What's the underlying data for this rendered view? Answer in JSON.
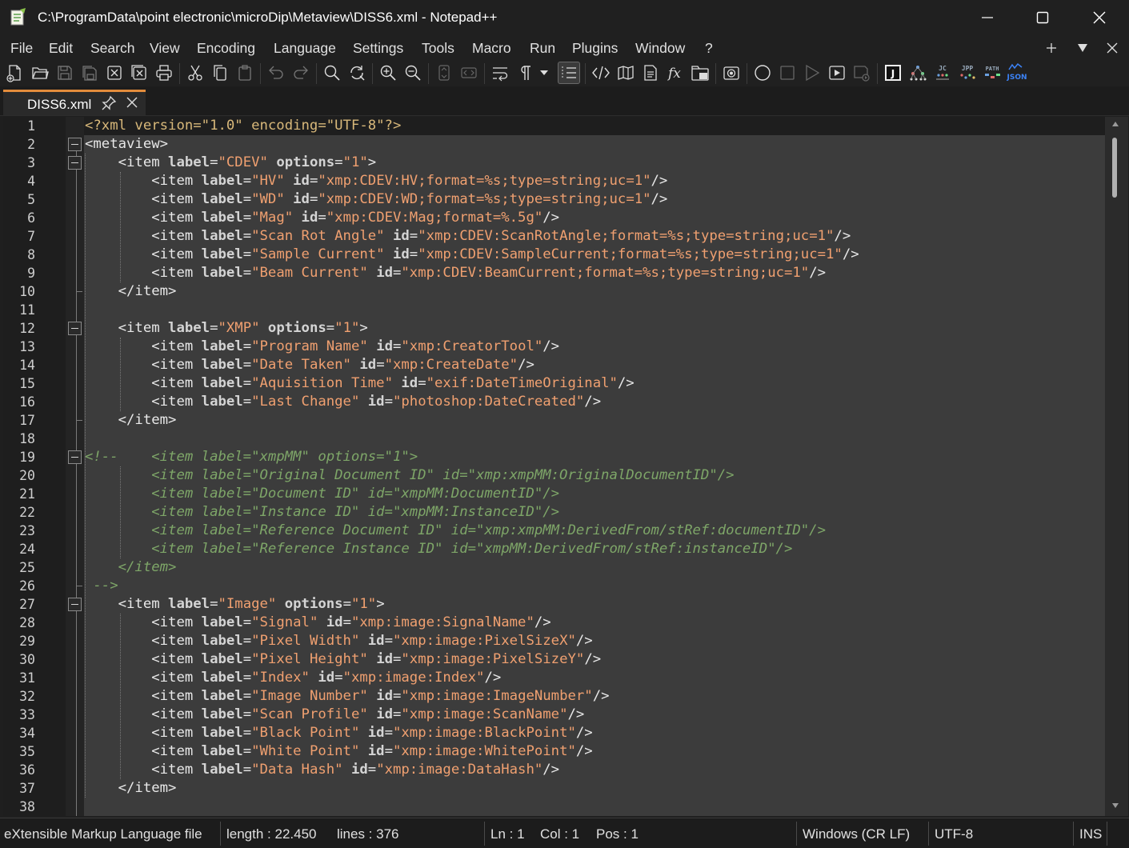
{
  "window": {
    "title": "C:\\ProgramData\\point electronic\\microDip\\Metaview\\DISS6.xml - Notepad++",
    "minimize_icon": "minimize-icon",
    "maximize_icon": "maximize-icon",
    "close_icon": "close-icon"
  },
  "menu": {
    "items": [
      "File",
      "Edit",
      "Search",
      "View",
      "Encoding",
      "Language",
      "Settings",
      "Tools",
      "Macro",
      "Run",
      "Plugins",
      "Window",
      "?"
    ],
    "right_icons": [
      "plus-icon",
      "dropdown-triangle-icon",
      "close-icon"
    ],
    "right_labels": [
      "+",
      "▼",
      "✕"
    ]
  },
  "toolbar": {
    "icons": [
      "new-file-icon",
      "open-folder-icon",
      "save-icon",
      "save-all-icon",
      "close-file-icon",
      "close-all-icon",
      "print-icon",
      "cut-icon",
      "copy-icon",
      "paste-icon",
      "undo-icon",
      "redo-icon",
      "find-icon",
      "replace-icon",
      "zoom-in-icon",
      "zoom-out-icon",
      "sync-vertical-icon",
      "sync-horizontal-icon",
      "word-wrap-icon",
      "show-all-characters-icon",
      "dropdown-icon",
      "indent-guide-icon",
      "xml-tag-icon",
      "document-map-icon",
      "document-list-icon",
      "function-list-icon",
      "folder-as-workspace-icon",
      "monitoring-icon",
      "record-macro-icon",
      "stop-macro-icon",
      "play-macro-icon",
      "run-macro-multiple-icon",
      "save-macro-icon",
      "jstool-icon",
      "plugin-tree-icon",
      "jc-plugin-icon",
      "jpp-plugin-icon",
      "path-plugin-icon",
      "json-plugin-icon"
    ],
    "plugin_labels": {
      "j": "J",
      "jc": "JC",
      "jpp": "JPP",
      "path": "PATH",
      "json": "JSON"
    }
  },
  "tabs": [
    {
      "label": "DISS6.xml",
      "pin_icon": "pin-icon",
      "close_icon": "close-icon",
      "active": true
    }
  ],
  "editor": {
    "current_line": 1,
    "lines": [
      [
        [
          "dec",
          "<?xml version=\"1.0\" encoding=\"UTF-8\"?>"
        ]
      ],
      [
        [
          "tag",
          "<metaview>"
        ]
      ],
      [
        [
          "tag",
          "    <item "
        ],
        [
          "att",
          "label"
        ],
        [
          "tag",
          "="
        ],
        [
          "val",
          "\"CDEV\""
        ],
        [
          "tag",
          " "
        ],
        [
          "att",
          "options"
        ],
        [
          "tag",
          "="
        ],
        [
          "val",
          "\"1\""
        ],
        [
          "tag",
          ">"
        ]
      ],
      [
        [
          "tag",
          "        <item "
        ],
        [
          "att",
          "label"
        ],
        [
          "tag",
          "="
        ],
        [
          "val",
          "\"HV\""
        ],
        [
          "tag",
          " "
        ],
        [
          "att",
          "id"
        ],
        [
          "tag",
          "="
        ],
        [
          "val",
          "\"xmp:CDEV:HV;format=%s;type=string;uc=1\""
        ],
        [
          "tag",
          "/>"
        ]
      ],
      [
        [
          "tag",
          "        <item "
        ],
        [
          "att",
          "label"
        ],
        [
          "tag",
          "="
        ],
        [
          "val",
          "\"WD\""
        ],
        [
          "tag",
          " "
        ],
        [
          "att",
          "id"
        ],
        [
          "tag",
          "="
        ],
        [
          "val",
          "\"xmp:CDEV:WD;format=%s;type=string;uc=1\""
        ],
        [
          "tag",
          "/>"
        ]
      ],
      [
        [
          "tag",
          "        <item "
        ],
        [
          "att",
          "label"
        ],
        [
          "tag",
          "="
        ],
        [
          "val",
          "\"Mag\""
        ],
        [
          "tag",
          " "
        ],
        [
          "att",
          "id"
        ],
        [
          "tag",
          "="
        ],
        [
          "val",
          "\"xmp:CDEV:Mag;format=%.5g\""
        ],
        [
          "tag",
          "/>"
        ]
      ],
      [
        [
          "tag",
          "        <item "
        ],
        [
          "att",
          "label"
        ],
        [
          "tag",
          "="
        ],
        [
          "val",
          "\"Scan Rot Angle\""
        ],
        [
          "tag",
          " "
        ],
        [
          "att",
          "id"
        ],
        [
          "tag",
          "="
        ],
        [
          "val",
          "\"xmp:CDEV:ScanRotAngle;format=%s;type=string;uc=1\""
        ],
        [
          "tag",
          "/>"
        ]
      ],
      [
        [
          "tag",
          "        <item "
        ],
        [
          "att",
          "label"
        ],
        [
          "tag",
          "="
        ],
        [
          "val",
          "\"Sample Current\""
        ],
        [
          "tag",
          " "
        ],
        [
          "att",
          "id"
        ],
        [
          "tag",
          "="
        ],
        [
          "val",
          "\"xmp:CDEV:SampleCurrent;format=%s;type=string;uc=1\""
        ],
        [
          "tag",
          "/>"
        ]
      ],
      [
        [
          "tag",
          "        <item "
        ],
        [
          "att",
          "label"
        ],
        [
          "tag",
          "="
        ],
        [
          "val",
          "\"Beam Current\""
        ],
        [
          "tag",
          " "
        ],
        [
          "att",
          "id"
        ],
        [
          "tag",
          "="
        ],
        [
          "val",
          "\"xmp:CDEV:BeamCurrent;format=%s;type=string;uc=1\""
        ],
        [
          "tag",
          "/>"
        ]
      ],
      [
        [
          "tag",
          "    </item>"
        ]
      ],
      [
        [
          "tag",
          ""
        ]
      ],
      [
        [
          "tag",
          "    <item "
        ],
        [
          "att",
          "label"
        ],
        [
          "tag",
          "="
        ],
        [
          "val",
          "\"XMP\""
        ],
        [
          "tag",
          " "
        ],
        [
          "att",
          "options"
        ],
        [
          "tag",
          "="
        ],
        [
          "val",
          "\"1\""
        ],
        [
          "tag",
          ">"
        ]
      ],
      [
        [
          "tag",
          "        <item "
        ],
        [
          "att",
          "label"
        ],
        [
          "tag",
          "="
        ],
        [
          "val",
          "\"Program Name\""
        ],
        [
          "tag",
          " "
        ],
        [
          "att",
          "id"
        ],
        [
          "tag",
          "="
        ],
        [
          "val",
          "\"xmp:CreatorTool\""
        ],
        [
          "tag",
          "/>"
        ]
      ],
      [
        [
          "tag",
          "        <item "
        ],
        [
          "att",
          "label"
        ],
        [
          "tag",
          "="
        ],
        [
          "val",
          "\"Date Taken\""
        ],
        [
          "tag",
          " "
        ],
        [
          "att",
          "id"
        ],
        [
          "tag",
          "="
        ],
        [
          "val",
          "\"xmp:CreateDate\""
        ],
        [
          "tag",
          "/>"
        ]
      ],
      [
        [
          "tag",
          "        <item "
        ],
        [
          "att",
          "label"
        ],
        [
          "tag",
          "="
        ],
        [
          "val",
          "\"Aquisition Time\""
        ],
        [
          "tag",
          " "
        ],
        [
          "att",
          "id"
        ],
        [
          "tag",
          "="
        ],
        [
          "val",
          "\"exif:DateTimeOriginal\""
        ],
        [
          "tag",
          "/>"
        ]
      ],
      [
        [
          "tag",
          "        <item "
        ],
        [
          "att",
          "label"
        ],
        [
          "tag",
          "="
        ],
        [
          "val",
          "\"Last Change\""
        ],
        [
          "tag",
          " "
        ],
        [
          "att",
          "id"
        ],
        [
          "tag",
          "="
        ],
        [
          "val",
          "\"photoshop:DateCreated\""
        ],
        [
          "tag",
          "/>"
        ]
      ],
      [
        [
          "tag",
          "    </item>"
        ]
      ],
      [
        [
          "tag",
          ""
        ]
      ],
      [
        [
          "com",
          "<!--    <item label=\"xmpMM\" options=\"1\">"
        ]
      ],
      [
        [
          "com",
          "        <item label=\"Original Document ID\" id=\"xmp:xmpMM:OriginalDocumentID\"/>"
        ]
      ],
      [
        [
          "com",
          "        <item label=\"Document ID\" id=\"xmpMM:DocumentID\"/>"
        ]
      ],
      [
        [
          "com",
          "        <item label=\"Instance ID\" id=\"xmpMM:InstanceID\"/>"
        ]
      ],
      [
        [
          "com",
          "        <item label=\"Reference Document ID\" id=\"xmp:xmpMM:DerivedFrom/stRef:documentID\"/>"
        ]
      ],
      [
        [
          "com",
          "        <item label=\"Reference Instance ID\" id=\"xmpMM:DerivedFrom/stRef:instanceID\"/>"
        ]
      ],
      [
        [
          "com",
          "    </item>"
        ]
      ],
      [
        [
          "com",
          " -->"
        ]
      ],
      [
        [
          "tag",
          "    <item "
        ],
        [
          "att",
          "label"
        ],
        [
          "tag",
          "="
        ],
        [
          "val",
          "\"Image\""
        ],
        [
          "tag",
          " "
        ],
        [
          "att",
          "options"
        ],
        [
          "tag",
          "="
        ],
        [
          "val",
          "\"1\""
        ],
        [
          "tag",
          ">"
        ]
      ],
      [
        [
          "tag",
          "        <item "
        ],
        [
          "att",
          "label"
        ],
        [
          "tag",
          "="
        ],
        [
          "val",
          "\"Signal\""
        ],
        [
          "tag",
          " "
        ],
        [
          "att",
          "id"
        ],
        [
          "tag",
          "="
        ],
        [
          "val",
          "\"xmp:image:SignalName\""
        ],
        [
          "tag",
          "/>"
        ]
      ],
      [
        [
          "tag",
          "        <item "
        ],
        [
          "att",
          "label"
        ],
        [
          "tag",
          "="
        ],
        [
          "val",
          "\"Pixel Width\""
        ],
        [
          "tag",
          " "
        ],
        [
          "att",
          "id"
        ],
        [
          "tag",
          "="
        ],
        [
          "val",
          "\"xmp:image:PixelSizeX\""
        ],
        [
          "tag",
          "/>"
        ]
      ],
      [
        [
          "tag",
          "        <item "
        ],
        [
          "att",
          "label"
        ],
        [
          "tag",
          "="
        ],
        [
          "val",
          "\"Pixel Height\""
        ],
        [
          "tag",
          " "
        ],
        [
          "att",
          "id"
        ],
        [
          "tag",
          "="
        ],
        [
          "val",
          "\"xmp:image:PixelSizeY\""
        ],
        [
          "tag",
          "/>"
        ]
      ],
      [
        [
          "tag",
          "        <item "
        ],
        [
          "att",
          "label"
        ],
        [
          "tag",
          "="
        ],
        [
          "val",
          "\"Index\""
        ],
        [
          "tag",
          " "
        ],
        [
          "att",
          "id"
        ],
        [
          "tag",
          "="
        ],
        [
          "val",
          "\"xmp:image:Index\""
        ],
        [
          "tag",
          "/>"
        ]
      ],
      [
        [
          "tag",
          "        <item "
        ],
        [
          "att",
          "label"
        ],
        [
          "tag",
          "="
        ],
        [
          "val",
          "\"Image Number\""
        ],
        [
          "tag",
          " "
        ],
        [
          "att",
          "id"
        ],
        [
          "tag",
          "="
        ],
        [
          "val",
          "\"xmp:image:ImageNumber\""
        ],
        [
          "tag",
          "/>"
        ]
      ],
      [
        [
          "tag",
          "        <item "
        ],
        [
          "att",
          "label"
        ],
        [
          "tag",
          "="
        ],
        [
          "val",
          "\"Scan Profile\""
        ],
        [
          "tag",
          " "
        ],
        [
          "att",
          "id"
        ],
        [
          "tag",
          "="
        ],
        [
          "val",
          "\"xmp:image:ScanName\""
        ],
        [
          "tag",
          "/>"
        ]
      ],
      [
        [
          "tag",
          "        <item "
        ],
        [
          "att",
          "label"
        ],
        [
          "tag",
          "="
        ],
        [
          "val",
          "\"Black Point\""
        ],
        [
          "tag",
          " "
        ],
        [
          "att",
          "id"
        ],
        [
          "tag",
          "="
        ],
        [
          "val",
          "\"xmp:image:BlackPoint\""
        ],
        [
          "tag",
          "/>"
        ]
      ],
      [
        [
          "tag",
          "        <item "
        ],
        [
          "att",
          "label"
        ],
        [
          "tag",
          "="
        ],
        [
          "val",
          "\"White Point\""
        ],
        [
          "tag",
          " "
        ],
        [
          "att",
          "id"
        ],
        [
          "tag",
          "="
        ],
        [
          "val",
          "\"xmp:image:WhitePoint\""
        ],
        [
          "tag",
          "/>"
        ]
      ],
      [
        [
          "tag",
          "        <item "
        ],
        [
          "att",
          "label"
        ],
        [
          "tag",
          "="
        ],
        [
          "val",
          "\"Data Hash\""
        ],
        [
          "tag",
          " "
        ],
        [
          "att",
          "id"
        ],
        [
          "tag",
          "="
        ],
        [
          "val",
          "\"xmp:image:DataHash\""
        ],
        [
          "tag",
          "/>"
        ]
      ],
      [
        [
          "tag",
          "    </item>"
        ]
      ],
      [
        [
          "tag",
          ""
        ]
      ]
    ]
  },
  "status": {
    "file_type": "eXtensible Markup Language file",
    "length": "length : 22.450",
    "lines": "lines : 376",
    "ln": "Ln : 1",
    "col": "Col : 1",
    "pos": "Pos : 1",
    "eol": "Windows (CR LF)",
    "encoding": "UTF-8",
    "mode": "INS"
  },
  "colors": {
    "background": "#1f1f1f",
    "editor_bg": "#3c3c3c",
    "tag": "#e8e8e8",
    "attribute": "#d4d4d4",
    "value": "#f0a070",
    "comment": "#7ea668",
    "tab_accent": "#e38c3c"
  }
}
